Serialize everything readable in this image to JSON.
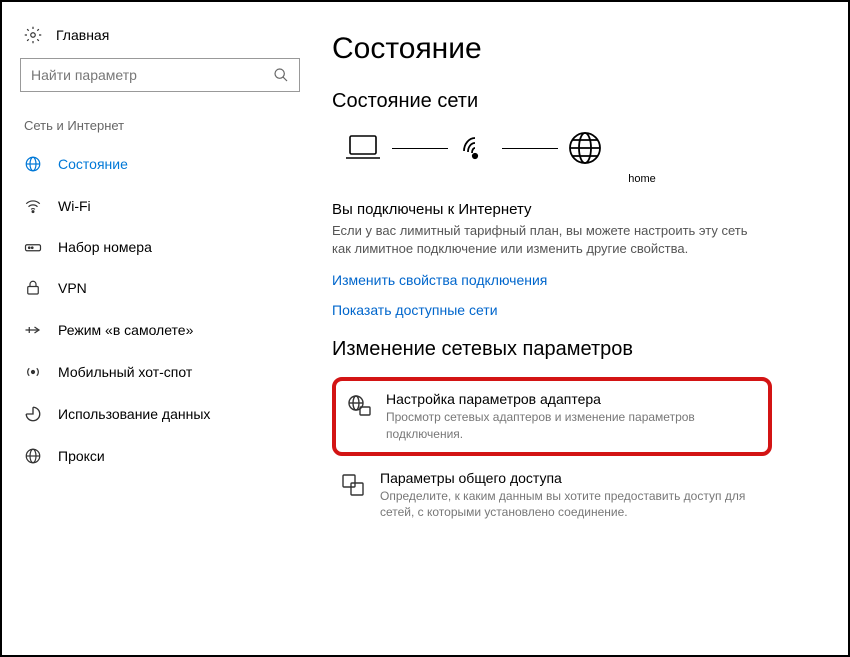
{
  "sidebar": {
    "home": "Главная",
    "search_placeholder": "Найти параметр",
    "category": "Сеть и Интернет",
    "items": [
      {
        "label": "Состояние"
      },
      {
        "label": "Wi-Fi"
      },
      {
        "label": "Набор номера"
      },
      {
        "label": "VPN"
      },
      {
        "label": "Режим «в самолете»"
      },
      {
        "label": "Мобильный хот-спот"
      },
      {
        "label": "Использование данных"
      },
      {
        "label": "Прокси"
      }
    ]
  },
  "main": {
    "title": "Состояние",
    "network_status": "Состояние сети",
    "wifi_name": "home",
    "connected_title": "Вы подключены к Интернету",
    "connected_desc": "Если у вас лимитный тарифный план, вы можете настроить эту сеть как лимитное подключение или изменить другие свойства.",
    "link_change": "Изменить свойства подключения",
    "link_show": "Показать доступные сети",
    "change_params_title": "Изменение сетевых параметров",
    "options": [
      {
        "title": "Настройка параметров адаптера",
        "desc": "Просмотр сетевых адаптеров и изменение параметров подключения."
      },
      {
        "title": "Параметры общего доступа",
        "desc": "Определите, к каким данным вы хотите предоставить доступ для сетей, с которыми установлено соединение."
      }
    ]
  }
}
